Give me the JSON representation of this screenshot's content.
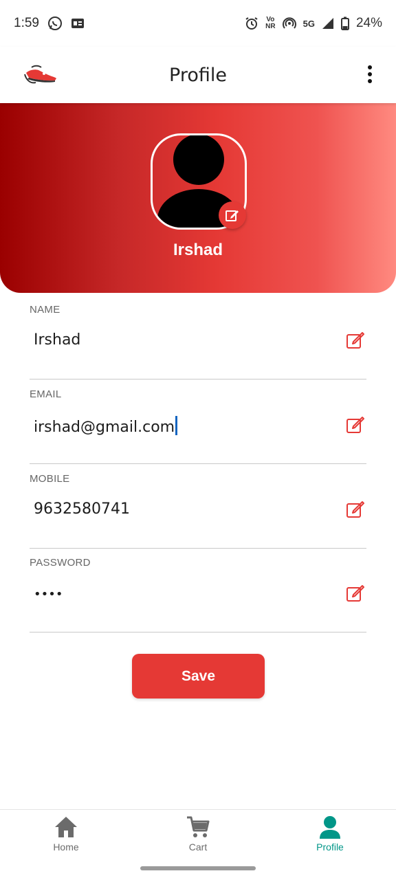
{
  "status_bar": {
    "time": "1:59",
    "battery": "24%",
    "network_label": "5G",
    "volte_label_top": "Vo",
    "volte_label_bottom": "NR"
  },
  "app_bar": {
    "title": "Profile",
    "logo_icon": "sneaker-logo-icon",
    "menu_icon": "more-vert-icon"
  },
  "profile": {
    "name": "Irshad",
    "avatar_icon": "person-silhouette-icon",
    "edit_icon": "edit-icon"
  },
  "form": {
    "fields": [
      {
        "label": "NAME",
        "value": "Irshad"
      },
      {
        "label": "EMAIL",
        "value": "irshad@gmail.com"
      },
      {
        "label": "MOBILE",
        "value": "9632580741"
      },
      {
        "label": "PASSWORD",
        "value": "••••"
      }
    ],
    "save_label": "Save"
  },
  "bottom_nav": {
    "items": [
      {
        "label": "Home",
        "icon": "home-icon"
      },
      {
        "label": "Cart",
        "icon": "cart-icon"
      },
      {
        "label": "Profile",
        "icon": "person-icon",
        "active": true
      }
    ]
  },
  "colors": {
    "accent": "#e53935",
    "active_nav": "#009688"
  }
}
